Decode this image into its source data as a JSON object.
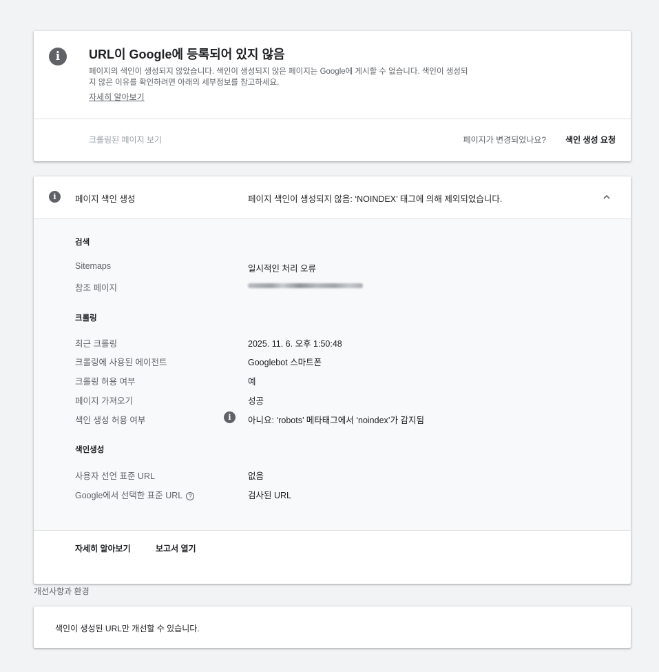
{
  "status": {
    "title": "URL이 Google에 등록되어 있지 않음",
    "description": "페이지의 색인이 생성되지 않았습니다. 색인이 생성되지 않은 페이지는 Google에 게시할 수 없습니다. 색인이 생성되지 않은 이유를 확인하려면 아래의 세부정보를 참고하세요.",
    "learn_more": "자세히 알아보기",
    "view_crawled": "크롤링된 페이지 보기",
    "page_changed": "페이지가 변경되었나요?",
    "request_indexing": "색인 생성 요청"
  },
  "detail": {
    "header_label": "페이지 색인 생성",
    "header_value": "페이지 색인이 생성되지 않음: ‘NOINDEX’ 태그에 의해 제외되었습니다.",
    "sections": {
      "discovery": {
        "title": "검색",
        "sitemaps_label": "Sitemaps",
        "sitemaps_value": "일시적인 처리 오류",
        "referring_label": "참조 페이지"
      },
      "crawl": {
        "title": "크롤링",
        "last_crawl_label": "최근 크롤링",
        "last_crawl_value": "2025. 11. 6. 오후 1:50:48",
        "agent_label": "크롤링에 사용된 에이전트",
        "agent_value": "Googlebot 스마트폰",
        "allowed_label": "크롤링 허용 여부",
        "allowed_value": "예",
        "fetch_label": "페이지 가져오기",
        "fetch_value": "성공",
        "indexing_allowed_label": "색인 생성 허용 여부",
        "indexing_allowed_value": "아니요: ‘robots’ 메타태그에서 ‘noindex’가 감지됨"
      },
      "indexing": {
        "title": "색인생성",
        "user_canonical_label": "사용자 선언 표준 URL",
        "user_canonical_value": "없음",
        "google_canonical_label": "Google에서 선택한 표준 URL",
        "google_canonical_help": "?",
        "google_canonical_value": "검사된 URL"
      }
    },
    "footer": {
      "learn_more": "자세히 알아보기",
      "open_report": "보고서 열기"
    }
  },
  "enhancements": {
    "heading": "개선사항과 환경",
    "message": "색인이 생성된 URL만 개선할 수 있습니다."
  },
  "icons": {
    "info": "info-icon",
    "chevron": "chevron-up-icon",
    "help": "help-circle-icon"
  },
  "colors": {
    "background": "#f1f3f4",
    "card": "#ffffff",
    "detail_body": "#f8f9fa",
    "icon_gray": "#5f6368"
  }
}
